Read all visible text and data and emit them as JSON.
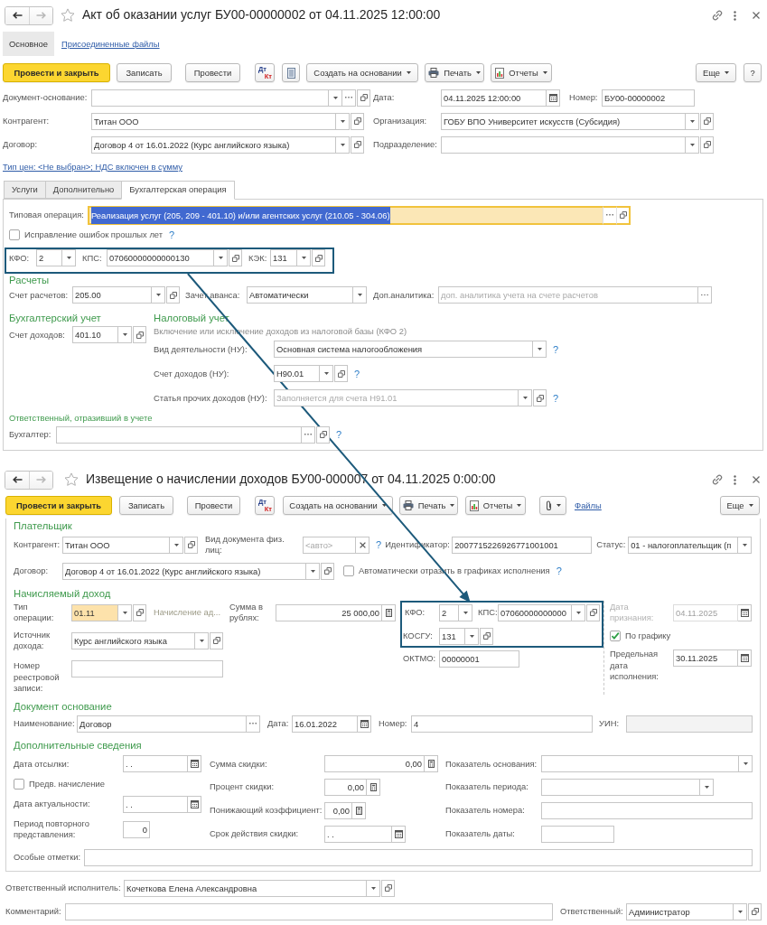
{
  "act_window": {
    "title": "Акт об оказании услуг БУ00-00000002 от 04.11.2025 12:00:00",
    "favorite": false,
    "navigation": [
      {
        "kind": "back",
        "disabled": false
      },
      {
        "kind": "forward",
        "disabled": true
      }
    ],
    "sections": [
      {
        "label": "Основное",
        "selected": true
      },
      {
        "label": "Присоединенные файлы",
        "selected": false
      }
    ],
    "toolbar": {
      "post_and_close": "Провести и закрыть",
      "save": "Записать",
      "post": "Провести",
      "debit": "Дт",
      "credit": "Кт",
      "create_based_on": "Создать на основании",
      "print": "Печать",
      "reports": "Отчеты",
      "more": "Еще",
      "help": "?"
    },
    "document_basis": {
      "label": "Документ-основание:"
    },
    "date": {
      "label": "Дата:",
      "value": "04.11.2025 12:00:00"
    },
    "number": {
      "label": "Номер:",
      "value": "БУ00-00000002"
    },
    "counterparty": {
      "label": "Контрагент:",
      "value": "Титан ООО"
    },
    "organization": {
      "label": "Организация:",
      "value": "ГОБУ ВПО Университет искусств (Субсидия)"
    },
    "contract": {
      "label": "Договор:",
      "value": "Договор 4 от 16.01.2022 (Курс английского языка)"
    },
    "department": {
      "label": "Подразделение:"
    },
    "price_link": "Тип цен: <Не выбран>; НДС включен в сумму",
    "tabs": [
      {
        "label": "Услуги",
        "selected": false
      },
      {
        "label": "Дополнительно",
        "selected": false
      },
      {
        "label": "Бухгалтерская операция",
        "selected": true
      }
    ],
    "operation": {
      "label": "Типовая операция:",
      "value": "Реализация услуг (205, 209 - 401.10) и/или агентских услуг (210.05 - 304.06)",
      "focused": true,
      "text_selected": true
    },
    "prior_year_fix": {
      "label": "Исправление ошибок прошлых лет",
      "checked": false,
      "help": "?"
    },
    "codes": [
      {
        "label": "КФО:",
        "value": "2"
      },
      {
        "label": "КПС:",
        "value": "07060000000000130"
      },
      {
        "label": "КЭК:",
        "value": "131"
      }
    ],
    "settlements": {
      "title": "Расчеты",
      "account": {
        "label": "Счет расчетов:",
        "value": "205.00"
      },
      "advance_offset": {
        "label": "Зачет аванса:",
        "value": "Автоматически"
      },
      "analytics": {
        "label": "Доп.аналитика:",
        "placeholder": "доп. аналитика учета на счете расчетов"
      }
    },
    "accounting": {
      "title": "Бухгалтерский учет",
      "income_account": {
        "label": "Счет доходов:",
        "value": "401.10"
      }
    },
    "tax_accounting": {
      "title": "Налоговый учет",
      "note": "Включение или исключение доходов из налоговой базы (КФО 2)",
      "activity": {
        "label": "Вид деятельности (НУ):",
        "value": "Основная система налогообложения",
        "help": "?"
      },
      "income_account": {
        "label": "Счет доходов (НУ):",
        "value": "Н90.01",
        "help": "?"
      },
      "other_income_item": {
        "label": "Статья прочих доходов (НУ):",
        "placeholder": "Заполняется для счета Н91.01",
        "help": "?"
      }
    },
    "responsible": {
      "title": "Ответственный, отразивший в учете",
      "accountant": {
        "label": "Бухгалтер:",
        "help": "?"
      }
    }
  },
  "notice_window": {
    "title": "Извещение о начислении доходов БУ00-000007 от 04.11.2025 0:00:00",
    "favorite": false,
    "navigation": [
      {
        "kind": "back",
        "disabled": false
      },
      {
        "kind": "forward",
        "disabled": true
      }
    ],
    "toolbar": {
      "post_and_close": "Провести и закрыть",
      "save": "Записать",
      "post": "Провести",
      "debit": "Дт",
      "credit": "Кт",
      "create_based_on": "Создать на основании",
      "print": "Печать",
      "reports": "Отчеты",
      "files": "Файлы",
      "more": "Еще"
    },
    "payer": {
      "title": "Плательщик",
      "counterparty": {
        "label": "Контрагент:",
        "value": "Титан ООО"
      },
      "id_document_type": {
        "label": "Вид документа физ. лиц:",
        "placeholder": "<авто>",
        "help": "?"
      },
      "identifier": {
        "label": "Идентификатор:",
        "value": "2007715226926771001001"
      },
      "status": {
        "label": "Статус:",
        "value": "01 - налогоплательщик (п"
      },
      "contract": {
        "label": "Договор:",
        "value": "Договор 4 от 16.01.2022 (Курс английского языка)"
      },
      "auto_schedule": {
        "label": "Автоматически отразить в графиках исполнения",
        "checked": false,
        "help": "?"
      }
    },
    "income": {
      "title": "Начисляемый доход",
      "operation_type": {
        "label": "Тип операции:",
        "value": "01.11",
        "highlighted": true
      },
      "operation_name": "Начисление ад...",
      "amount": {
        "label": "Сумма в рублях:",
        "value": "25 000,00"
      },
      "codes": [
        {
          "label": "КФО:",
          "value": "2"
        },
        {
          "label": "КПС:",
          "value": "07060000000000"
        },
        {
          "label": "КОСГУ:",
          "value": "131"
        }
      ],
      "recognition_date": {
        "label": "Дата признания:",
        "value": "04.11.2025",
        "disabled": true
      },
      "by_schedule": {
        "label": "По графику",
        "checked": true
      },
      "source": {
        "label": "Источник дохода:",
        "value": "Курс английского языка"
      },
      "oktmo": {
        "label": "ОКТМО:",
        "value": "00000001"
      },
      "registry_number": {
        "label": "Номер реестровой записи:"
      },
      "deadline": {
        "label": "Предельная дата исполнения:",
        "value": "30.11.2025"
      }
    },
    "basis_document": {
      "title": "Документ основание",
      "name": {
        "label": "Наименование:",
        "value": "Договор"
      },
      "date": {
        "label": "Дата:",
        "value": "16.01.2022"
      },
      "number": {
        "label": "Номер:",
        "value": "4"
      },
      "uin": {
        "label": "УИН:",
        "read_only": true
      }
    },
    "additional": {
      "title": "Дополнительные сведения",
      "sent_date": {
        "label": "Дата отсылки:",
        "value": ". ."
      },
      "preliminary": {
        "label": "Предв. начисление",
        "checked": false
      },
      "relevance_date": {
        "label": "Дата актуальности:",
        "value": ". ."
      },
      "resubmission_period": {
        "label": "Период повторного представления:",
        "value": "0"
      },
      "discount_amount": {
        "label": "Сумма скидки:",
        "value": "0,00"
      },
      "discount_percent": {
        "label": "Процент скидки:",
        "value": "0,00"
      },
      "reduction_factor": {
        "label": "Понижающий коэффициент:",
        "value": "0,00"
      },
      "discount_validity": {
        "label": "Срок действия скидки:",
        "value": ". ."
      },
      "basis_indicator": {
        "label": "Показатель основания:"
      },
      "period_indicator": {
        "label": "Показатель периода:"
      },
      "number_indicator": {
        "label": "Показатель номера:"
      },
      "date_indicator": {
        "label": "Показатель даты:"
      },
      "special_marks": {
        "label": "Особые отметки:"
      }
    },
    "executor": {
      "label": "Ответственный исполнитель:",
      "value": "Кочеткова Елена Александровна"
    },
    "comment": {
      "label": "Комментарий:"
    },
    "responsible": {
      "label": "Ответственный:",
      "value": "Администратор"
    }
  }
}
